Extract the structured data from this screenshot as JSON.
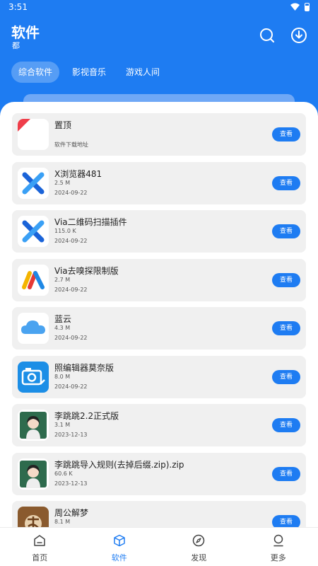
{
  "status": {
    "time": "3:51"
  },
  "header": {
    "title": "软件",
    "subtitle": "都"
  },
  "tabs": [
    {
      "label": "综合软件",
      "active": true
    },
    {
      "label": "影视音乐",
      "active": false
    },
    {
      "label": "游戏人间",
      "active": false
    }
  ],
  "items": [
    {
      "name": "置顶",
      "size": "",
      "date": "软件下载地址",
      "button": "查看",
      "icon": "pin-red-icon"
    },
    {
      "name": "X浏览器481",
      "size": "2.5 M",
      "date": "2024-09-22",
      "button": "查看",
      "icon": "x-browser-icon"
    },
    {
      "name": "Via二维码扫描插件",
      "size": "115.0 K",
      "date": "2024-09-22",
      "button": "查看",
      "icon": "x-browser-icon"
    },
    {
      "name": "Via去嗅探限制版",
      "size": "2.7 M",
      "date": "2024-09-22",
      "button": "查看",
      "icon": "via-icon"
    },
    {
      "name": "蓝云",
      "size": "4.3 M",
      "date": "2024-09-22",
      "button": "查看",
      "icon": "cloud-icon"
    },
    {
      "name": "照编辑器莫奈版",
      "size": "8.0 M",
      "date": "2024-09-22",
      "button": "查看",
      "icon": "camera-icon"
    },
    {
      "name": "李跳跳2.2正式版",
      "size": "3.1 M",
      "date": "2023-12-13",
      "button": "查看",
      "icon": "girl-avatar-icon"
    },
    {
      "name": " 李跳跳导入规则(去掉后缀.zip).zip",
      "size": "60.6 K",
      "date": "2023-12-13",
      "button": "查看",
      "icon": "girl-avatar-icon"
    },
    {
      "name": "周公解梦",
      "size": "8.1 M",
      "date": "",
      "button": "查看",
      "icon": "dream-icon"
    }
  ],
  "nav": [
    {
      "label": "首页",
      "icon": "home-icon",
      "active": false
    },
    {
      "label": "软件",
      "icon": "cube-icon",
      "active": true
    },
    {
      "label": "发现",
      "icon": "compass-icon",
      "active": false
    },
    {
      "label": "更多",
      "icon": "profile-icon",
      "active": false
    }
  ],
  "colors": {
    "primary": "#1e7cf2",
    "card": "#f0f0f0"
  }
}
